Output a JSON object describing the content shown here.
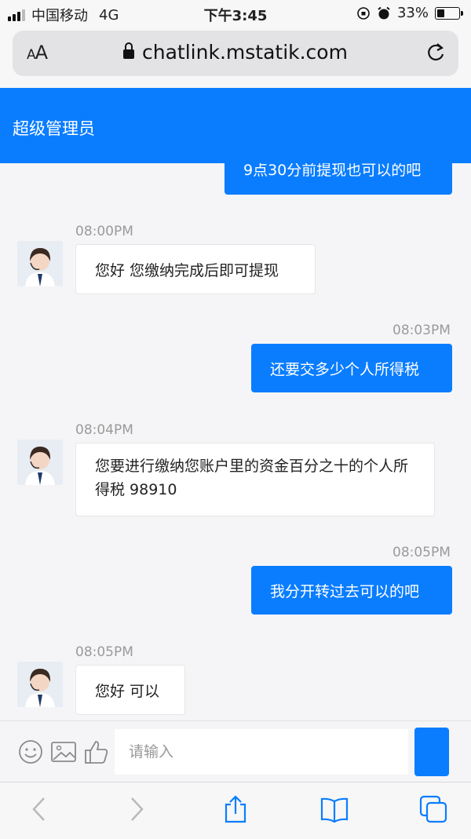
{
  "status": {
    "carrier": "中国移动",
    "network": "4G",
    "time": "下午3:45",
    "battery": "33%",
    "battery_level": 0.33
  },
  "browser": {
    "text_size_label": "AA",
    "url": "chatlink.mstatik.com"
  },
  "header": {
    "title": "超级管理员"
  },
  "messages": [
    {
      "direction": "out",
      "time": "",
      "text": "9点30分前提现也可以的吧"
    },
    {
      "direction": "in",
      "time": "08:00PM",
      "text": "您好 您缴纳完成后即可提现"
    },
    {
      "direction": "out",
      "time": "08:03PM",
      "text": "还要交多少个人所得税"
    },
    {
      "direction": "in",
      "time": "08:04PM",
      "text": "您要进行缴纳您账户里的资金百分之十的个人所得税 98910"
    },
    {
      "direction": "out",
      "time": "08:05PM",
      "text": "我分开转过去可以的吧"
    },
    {
      "direction": "in",
      "time": "08:05PM",
      "text": "您好 可以"
    }
  ],
  "input": {
    "placeholder": "请输入"
  },
  "icons": {
    "emoji": "smiley-icon",
    "image": "image-icon",
    "like": "thumbs-up-icon"
  },
  "colors": {
    "primary": "#0a7dff",
    "background": "#f5f5f7"
  }
}
